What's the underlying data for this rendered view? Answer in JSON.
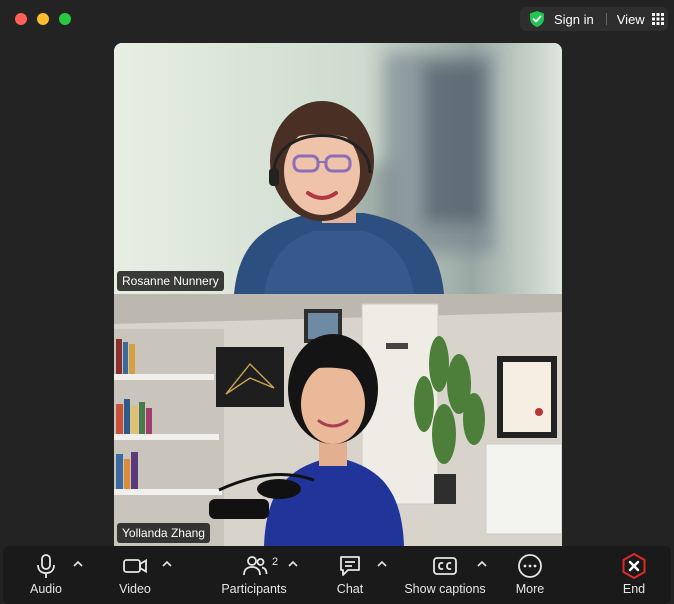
{
  "window": {
    "signin_label": "Sign in",
    "view_label": "View",
    "colors": {
      "background": "#232323",
      "toolbar": "#1a1a1a",
      "end_red": "#e02828",
      "shield_green": "#23c552"
    }
  },
  "icons": {
    "security": "shield-check-icon",
    "view": "grid-icon",
    "audio": "microphone-icon",
    "video": "video-camera-icon",
    "participants": "people-icon",
    "chat": "chat-bubble-icon",
    "captions": "cc-icon",
    "more": "ellipsis-icon",
    "end": "close-hexagon-icon"
  },
  "participants": [
    {
      "name": "Rosanne Nunnery"
    },
    {
      "name": "Yollanda Zhang"
    }
  ],
  "toolbar": {
    "audio_label": "Audio",
    "video_label": "Video",
    "participants_label": "Participants",
    "participants_count": "2",
    "chat_label": "Chat",
    "captions_label": "Show captions",
    "more_label": "More",
    "end_label": "End"
  }
}
